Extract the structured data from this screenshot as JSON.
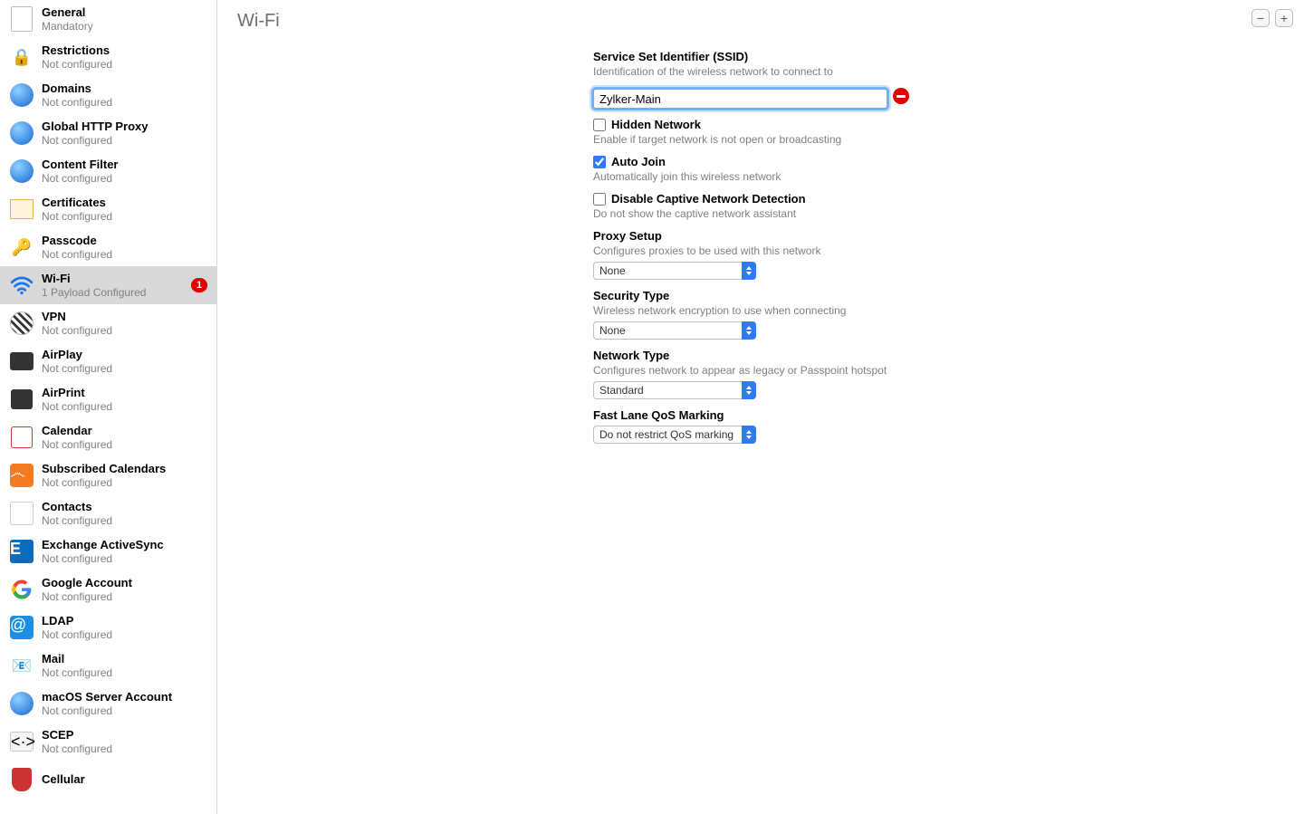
{
  "sidebar": {
    "items": [
      {
        "title": "General",
        "sub": "Mandatory",
        "icon": "general-icon"
      },
      {
        "title": "Restrictions",
        "sub": "Not configured",
        "icon": "lock-icon"
      },
      {
        "title": "Domains",
        "sub": "Not configured",
        "icon": "globe-icon"
      },
      {
        "title": "Global HTTP Proxy",
        "sub": "Not configured",
        "icon": "globe-gear-icon"
      },
      {
        "title": "Content Filter",
        "sub": "Not configured",
        "icon": "globe-shield-icon"
      },
      {
        "title": "Certificates",
        "sub": "Not configured",
        "icon": "certificate-icon"
      },
      {
        "title": "Passcode",
        "sub": "Not configured",
        "icon": "key-icon"
      },
      {
        "title": "Wi-Fi",
        "sub": "1 Payload Configured",
        "icon": "wifi-icon",
        "badge": "1",
        "selected": true
      },
      {
        "title": "VPN",
        "sub": "Not configured",
        "icon": "vpn-icon"
      },
      {
        "title": "AirPlay",
        "sub": "Not configured",
        "icon": "airplay-icon"
      },
      {
        "title": "AirPrint",
        "sub": "Not configured",
        "icon": "airprint-icon"
      },
      {
        "title": "Calendar",
        "sub": "Not configured",
        "icon": "calendar-icon"
      },
      {
        "title": "Subscribed Calendars",
        "sub": "Not configured",
        "icon": "rss-icon"
      },
      {
        "title": "Contacts",
        "sub": "Not configured",
        "icon": "contacts-icon"
      },
      {
        "title": "Exchange ActiveSync",
        "sub": "Not configured",
        "icon": "exchange-icon"
      },
      {
        "title": "Google Account",
        "sub": "Not configured",
        "icon": "google-icon"
      },
      {
        "title": "LDAP",
        "sub": "Not configured",
        "icon": "at-icon"
      },
      {
        "title": "Mail",
        "sub": "Not configured",
        "icon": "mail-icon"
      },
      {
        "title": "macOS Server Account",
        "sub": "Not configured",
        "icon": "globe-server-icon"
      },
      {
        "title": "SCEP",
        "sub": "Not configured",
        "icon": "scep-icon"
      },
      {
        "title": "Cellular",
        "sub": "",
        "icon": "cellular-icon"
      }
    ]
  },
  "header": {
    "title": "Wi-Fi",
    "minus": "−",
    "plus": "+"
  },
  "form": {
    "ssid": {
      "label": "Service Set Identifier (SSID)",
      "desc": "Identification of the wireless network to connect to",
      "value": "Zylker-Main"
    },
    "hidden": {
      "label": "Hidden Network",
      "desc": "Enable if target network is not open or broadcasting",
      "checked": false
    },
    "auto_join": {
      "label": "Auto Join",
      "desc": "Automatically join this wireless network",
      "checked": true
    },
    "captive": {
      "label": "Disable Captive Network Detection",
      "desc": "Do not show the captive network assistant",
      "checked": false
    },
    "proxy": {
      "label": "Proxy Setup",
      "desc": "Configures proxies to be used with this network",
      "value": "None"
    },
    "security": {
      "label": "Security Type",
      "desc": "Wireless network encryption to use when connecting",
      "value": "None"
    },
    "network_type": {
      "label": "Network Type",
      "desc": "Configures network to appear as legacy or Passpoint hotspot",
      "value": "Standard"
    },
    "fastlane": {
      "label": "Fast Lane QoS Marking",
      "value": "Do not restrict QoS marking"
    }
  }
}
